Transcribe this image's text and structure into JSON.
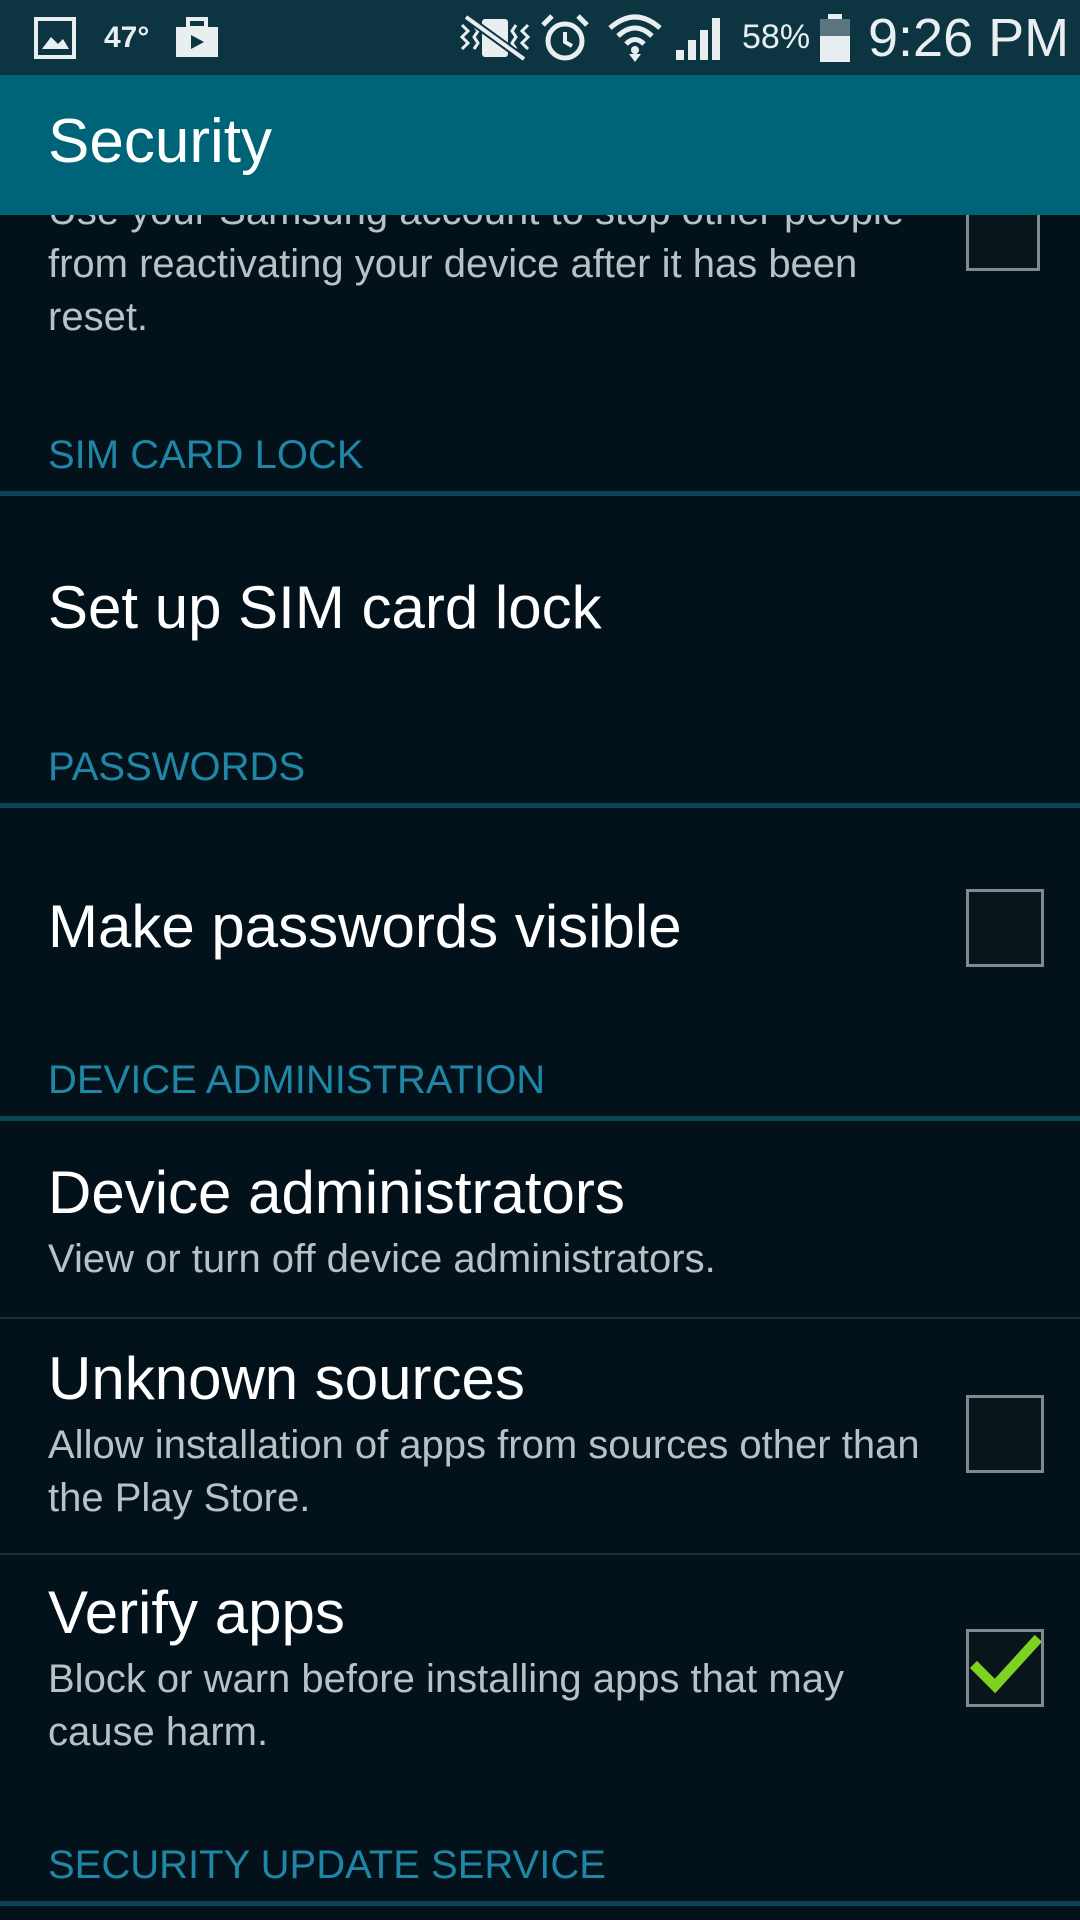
{
  "status_bar": {
    "temperature": "47°",
    "battery_percent": "58%",
    "time": "9:26 PM",
    "icons": [
      "gallery-icon",
      "work-bag-icon",
      "vibrate-icon",
      "alarm-icon",
      "wifi-icon",
      "signal-icon",
      "battery-icon"
    ]
  },
  "action_bar": {
    "title": "Security"
  },
  "reactivation_lock": {
    "summary": "Use your Samsung account to stop other people from reactivating your device after it has been reset.",
    "checked": false
  },
  "sections": {
    "sim_card_lock": "SIM CARD LOCK",
    "passwords": "PASSWORDS",
    "device_administration": "DEVICE ADMINISTRATION",
    "security_update_service": "SECURITY UPDATE SERVICE"
  },
  "items": {
    "sim_lock": {
      "title": "Set up SIM card lock"
    },
    "make_passwords_visible": {
      "title": "Make passwords visible",
      "checked": false
    },
    "device_administrators": {
      "title": "Device administrators",
      "summary": "View or turn off device administrators."
    },
    "unknown_sources": {
      "title": "Unknown sources",
      "summary": "Allow installation of apps from sources other than the Play Store.",
      "checked": false
    },
    "verify_apps": {
      "title": "Verify apps",
      "summary": "Block or warn before installing apps that may cause harm.",
      "checked": true
    }
  },
  "colors": {
    "status_bar_bg": "#0d3441",
    "action_bar_bg": "#006479",
    "background": "#03121a",
    "section_header": "#1f86a6",
    "check_mark": "#7ed321"
  }
}
